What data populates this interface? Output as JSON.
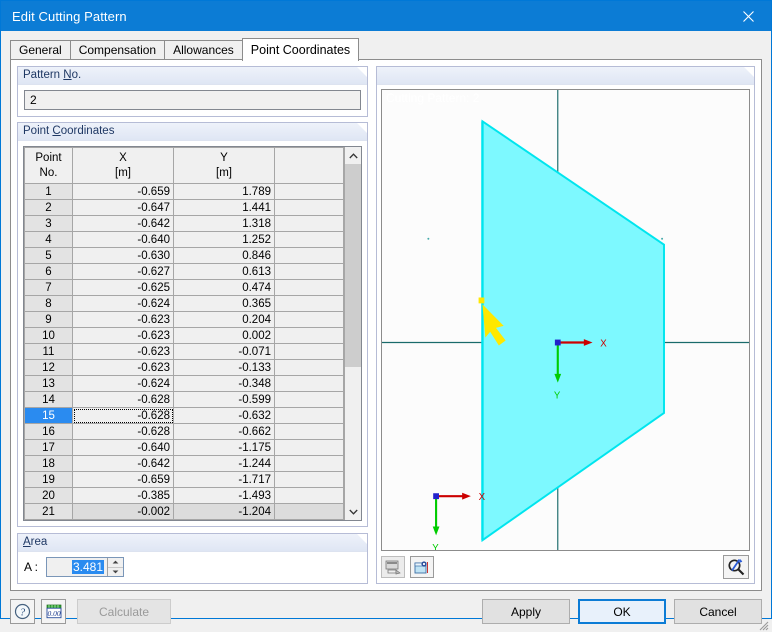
{
  "window": {
    "title": "Edit Cutting Pattern",
    "close_icon": "close-icon"
  },
  "tabs": [
    {
      "label": "General",
      "active": false
    },
    {
      "label": "Compensation",
      "active": false
    },
    {
      "label": "Allowances",
      "active": false
    },
    {
      "label": "Point Coordinates",
      "active": true
    }
  ],
  "pattern_group": {
    "title": "Pattern No.",
    "value": "2"
  },
  "coordinates_group": {
    "title": "Point Coordinates",
    "headers": {
      "point_no": [
        "Point",
        "No."
      ],
      "x": [
        "X",
        "[m]"
      ],
      "y": [
        "Y",
        "[m]"
      ],
      "extra": ""
    },
    "rows": [
      {
        "no": "1",
        "x": "-0.659",
        "y": "1.789"
      },
      {
        "no": "2",
        "x": "-0.647",
        "y": "1.441"
      },
      {
        "no": "3",
        "x": "-0.642",
        "y": "1.318"
      },
      {
        "no": "4",
        "x": "-0.640",
        "y": "1.252"
      },
      {
        "no": "5",
        "x": "-0.630",
        "y": "0.846"
      },
      {
        "no": "6",
        "x": "-0.627",
        "y": "0.613"
      },
      {
        "no": "7",
        "x": "-0.625",
        "y": "0.474"
      },
      {
        "no": "8",
        "x": "-0.624",
        "y": "0.365"
      },
      {
        "no": "9",
        "x": "-0.623",
        "y": "0.204"
      },
      {
        "no": "10",
        "x": "-0.623",
        "y": "0.002"
      },
      {
        "no": "11",
        "x": "-0.623",
        "y": "-0.071"
      },
      {
        "no": "12",
        "x": "-0.623",
        "y": "-0.133"
      },
      {
        "no": "13",
        "x": "-0.624",
        "y": "-0.348"
      },
      {
        "no": "14",
        "x": "-0.628",
        "y": "-0.599"
      },
      {
        "no": "15",
        "x": "-0.628",
        "y": "-0.632"
      },
      {
        "no": "16",
        "x": "-0.628",
        "y": "-0.662"
      },
      {
        "no": "17",
        "x": "-0.640",
        "y": "-1.175"
      },
      {
        "no": "18",
        "x": "-0.642",
        "y": "-1.244"
      },
      {
        "no": "19",
        "x": "-0.659",
        "y": "-1.717"
      },
      {
        "no": "20",
        "x": "-0.385",
        "y": "-1.493"
      },
      {
        "no": "21",
        "x": "-0.002",
        "y": "-1.204"
      }
    ],
    "selected_row_index": 14,
    "scrollbar": {
      "up_icon": "chevron-up-icon",
      "down_icon": "chevron-down-icon",
      "thumb_position_percent": 0,
      "thumb_size_percent": 60
    }
  },
  "area_group": {
    "title": "Area",
    "label": "A :",
    "value": "3.481",
    "spinner_up_icon": "spinner-up-icon",
    "spinner_down_icon": "spinner-down-icon"
  },
  "graphics": {
    "overlay_label": "Cutting Pattern: 2",
    "axis_labels": {
      "x": "X",
      "y": "Y"
    },
    "colors": {
      "fill": "#7df9ff",
      "outline": "#00e5ee",
      "grid": "#1a6b6b",
      "axis_x": "#cc0000",
      "axis_y": "#00cc00",
      "arrow": "#ffe800",
      "origin": "#2222cc"
    },
    "toolbar": [
      {
        "icon": "print-graphic-icon",
        "disabled": true
      },
      {
        "icon": "view-settings-icon",
        "disabled": false
      },
      {
        "icon": "zoom-reset-icon",
        "disabled": false
      }
    ]
  },
  "footer": {
    "help_icon": "help-icon",
    "units_icon": "units-icon",
    "calculate_label": "Calculate",
    "apply_label": "Apply",
    "ok_label": "OK",
    "cancel_label": "Cancel",
    "resize_grip_icon": "resize-grip-icon"
  }
}
